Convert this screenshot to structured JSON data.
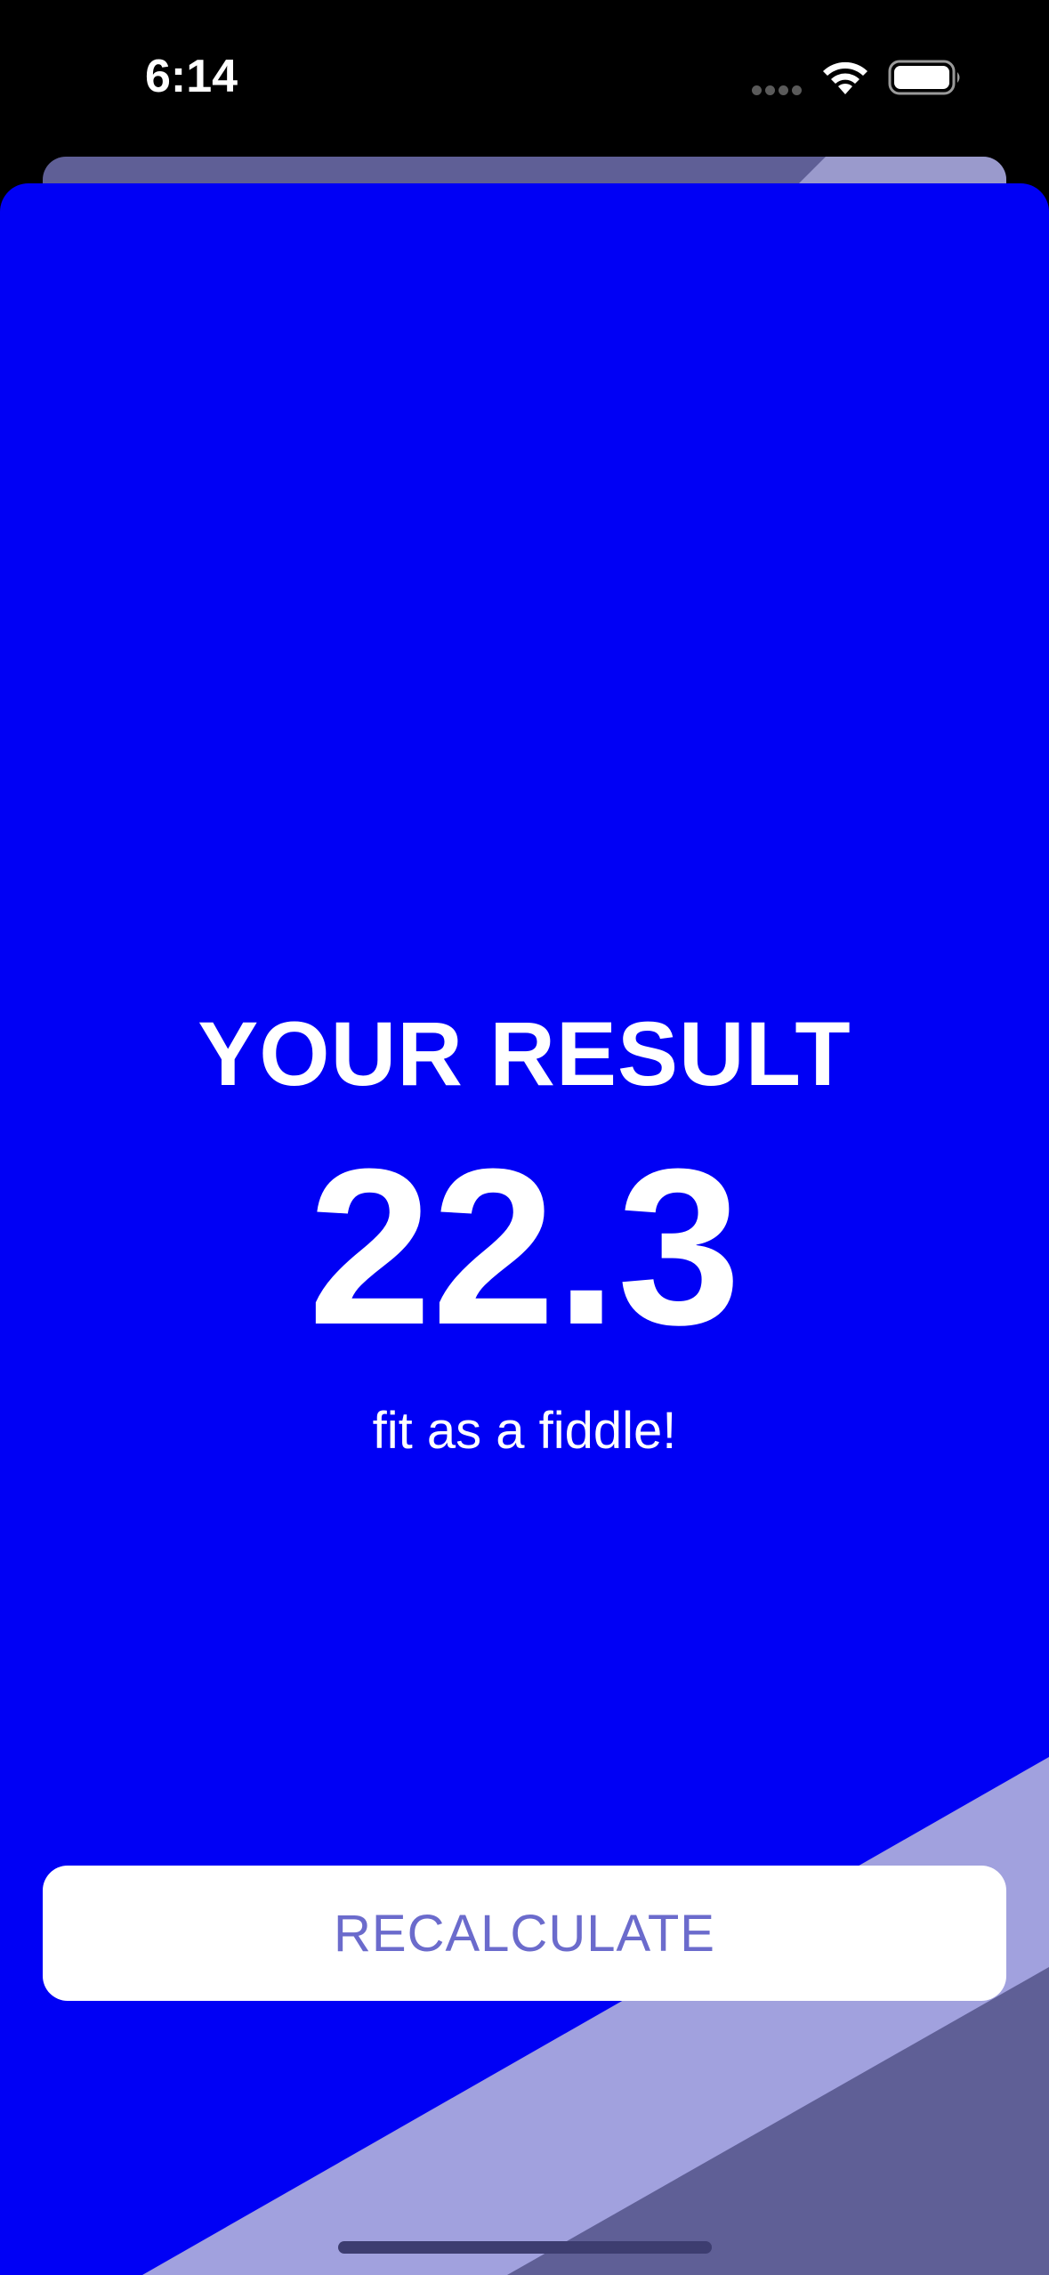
{
  "status_bar": {
    "time": "6:14",
    "signal_icon": "cellular-dots-icon",
    "wifi_icon": "wifi-icon",
    "battery_icon": "battery-icon"
  },
  "colors": {
    "background": "#000000",
    "card": "#0000f5",
    "stripe_light": "#a1a1de",
    "stripe_dark": "#5f5f96",
    "button_bg": "#ffffff",
    "button_text": "#6b6bcc",
    "text": "#ffffff"
  },
  "result": {
    "heading": "YOUR RESULT",
    "value": "22.3",
    "message": "fit as a fiddle!"
  },
  "button": {
    "label": "RECALCULATE"
  }
}
